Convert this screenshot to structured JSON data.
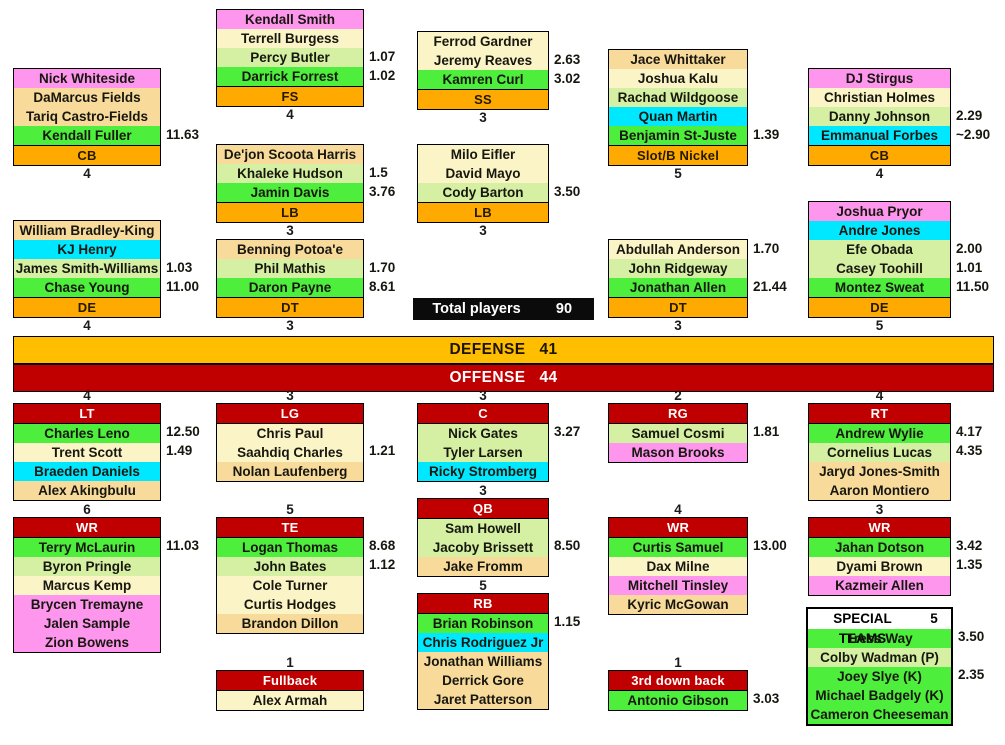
{
  "meta": {
    "total_label": "Total players",
    "total_value": "90",
    "defense_label": "DEFENSE",
    "defense_value": "41",
    "offense_label": "OFFENSE",
    "offense_value": "44"
  },
  "colors": {
    "defense_header": "#FFAA00",
    "offense_header": "#C00000",
    "banner_defense": "#FFBF00",
    "banner_offense": "#C00000",
    "tier_magenta": "#FF96EE",
    "tier_cyan": "#00E8FF",
    "tier_green": "#4DEE3C",
    "tier_light_green": "#D5F0A2",
    "tier_cream": "#FBF4C6",
    "tier_tan": "#F8DA9B",
    "total_box": "#0b0b0b"
  },
  "defense": [
    {
      "id": "cb-left",
      "position": "CB",
      "count": "4",
      "players": [
        {
          "name": "Nick Whiteside",
          "tier": "magenta",
          "value": ""
        },
        {
          "name": "DaMarcus Fields",
          "tier": "tan",
          "value": ""
        },
        {
          "name": "Tariq Castro-Fields",
          "tier": "tan",
          "value": ""
        },
        {
          "name": "Kendall Fuller",
          "tier": "green",
          "value": "11.63"
        }
      ]
    },
    {
      "id": "fs",
      "position": "FS",
      "count": "4",
      "players": [
        {
          "name": "Kendall Smith",
          "tier": "magenta",
          "value": ""
        },
        {
          "name": "Terrell Burgess",
          "tier": "cream",
          "value": ""
        },
        {
          "name": "Percy Butler",
          "tier": "ltgreen",
          "value": "1.07"
        },
        {
          "name": "Darrick Forrest",
          "tier": "green",
          "value": "1.02"
        }
      ]
    },
    {
      "id": "ss",
      "position": "SS",
      "count": "3",
      "players": [
        {
          "name": "Ferrod Gardner",
          "tier": "cream",
          "value": ""
        },
        {
          "name": "Jeremy Reaves",
          "tier": "cream",
          "value": "2.63"
        },
        {
          "name": "Kamren Curl",
          "tier": "green",
          "value": "3.02"
        }
      ]
    },
    {
      "id": "slot-nickel",
      "position": "Slot/B Nickel",
      "count": "5",
      "players": [
        {
          "name": "Jace Whittaker",
          "tier": "tan",
          "value": ""
        },
        {
          "name": "Joshua Kalu",
          "tier": "cream",
          "value": ""
        },
        {
          "name": "Rachad Wildgoose",
          "tier": "ltgreen",
          "value": ""
        },
        {
          "name": "Quan Martin",
          "tier": "cyan",
          "value": ""
        },
        {
          "name": "Benjamin St-Juste",
          "tier": "green",
          "value": "1.39"
        }
      ]
    },
    {
      "id": "cb-right",
      "position": "CB",
      "count": "4",
      "players": [
        {
          "name": "DJ Stirgus",
          "tier": "magenta",
          "value": ""
        },
        {
          "name": "Christian Holmes",
          "tier": "cream",
          "value": ""
        },
        {
          "name": "Danny Johnson",
          "tier": "ltgreen",
          "value": "2.29"
        },
        {
          "name": "Emmanual Forbes",
          "tier": "cyan",
          "value": "~2.90"
        }
      ]
    },
    {
      "id": "lb-left",
      "position": "LB",
      "count": "3",
      "players": [
        {
          "name": "De'jon Scoota Harris",
          "tier": "tan",
          "value": ""
        },
        {
          "name": "Khaleke Hudson",
          "tier": "ltgreen",
          "value": "1.5"
        },
        {
          "name": "Jamin Davis",
          "tier": "green",
          "value": "3.76"
        }
      ]
    },
    {
      "id": "lb-right",
      "position": "LB",
      "count": "3",
      "players": [
        {
          "name": "Milo Eifler",
          "tier": "cream",
          "value": ""
        },
        {
          "name": "David Mayo",
          "tier": "cream",
          "value": ""
        },
        {
          "name": "Cody Barton",
          "tier": "ltgreen",
          "value": "3.50"
        }
      ]
    },
    {
      "id": "de-left",
      "position": "DE",
      "count": "4",
      "players": [
        {
          "name": "William Bradley-King",
          "tier": "tan",
          "value": ""
        },
        {
          "name": "KJ Henry",
          "tier": "cyan",
          "value": ""
        },
        {
          "name": "James Smith-Williams",
          "tier": "ltgreen",
          "value": "1.03"
        },
        {
          "name": "Chase Young",
          "tier": "green",
          "value": "11.00"
        }
      ]
    },
    {
      "id": "dt-left",
      "position": "DT",
      "count": "3",
      "players": [
        {
          "name": "Benning Potoa'e",
          "tier": "tan",
          "value": ""
        },
        {
          "name": "Phil Mathis",
          "tier": "ltgreen",
          "value": "1.70"
        },
        {
          "name": "Daron Payne",
          "tier": "green",
          "value": "8.61"
        }
      ]
    },
    {
      "id": "dt-right",
      "position": "DT",
      "count": "3",
      "players": [
        {
          "name": "Abdullah Anderson",
          "tier": "cream",
          "value": "1.70"
        },
        {
          "name": "John Ridgeway",
          "tier": "ltgreen",
          "value": ""
        },
        {
          "name": "Jonathan Allen",
          "tier": "green",
          "value": "21.44"
        }
      ]
    },
    {
      "id": "de-right",
      "position": "DE",
      "count": "5",
      "players": [
        {
          "name": "Joshua Pryor",
          "tier": "magenta",
          "value": ""
        },
        {
          "name": "Andre Jones",
          "tier": "cyan",
          "value": ""
        },
        {
          "name": "Efe Obada",
          "tier": "ltgreen",
          "value": "2.00"
        },
        {
          "name": "Casey Toohill",
          "tier": "ltgreen",
          "value": "1.01"
        },
        {
          "name": "Montez Sweat",
          "tier": "green",
          "value": "11.50"
        }
      ]
    }
  ],
  "offense": [
    {
      "id": "lt",
      "position": "LT",
      "count": "4",
      "players": [
        {
          "name": "Charles Leno",
          "tier": "green",
          "value": "12.50"
        },
        {
          "name": "Trent Scott",
          "tier": "cream",
          "value": "1.49"
        },
        {
          "name": "Braeden Daniels",
          "tier": "cyan",
          "value": ""
        },
        {
          "name": "Alex Akingbulu",
          "tier": "tan",
          "value": ""
        }
      ]
    },
    {
      "id": "lg",
      "position": "LG",
      "count": "3",
      "players": [
        {
          "name": "Chris Paul",
          "tier": "cream",
          "value": ""
        },
        {
          "name": "Saahdiq Charles",
          "tier": "cream",
          "value": "1.21"
        },
        {
          "name": "Nolan Laufenberg",
          "tier": "tan",
          "value": ""
        }
      ]
    },
    {
      "id": "c",
      "position": "C",
      "count": "3",
      "players": [
        {
          "name": "Nick Gates",
          "tier": "ltgreen",
          "value": "3.27"
        },
        {
          "name": "Tyler Larsen",
          "tier": "ltgreen",
          "value": ""
        },
        {
          "name": "Ricky Stromberg",
          "tier": "cyan",
          "value": ""
        }
      ]
    },
    {
      "id": "rg",
      "position": "RG",
      "count": "2",
      "players": [
        {
          "name": "Samuel Cosmi",
          "tier": "ltgreen",
          "value": "1.81"
        },
        {
          "name": "Mason Brooks",
          "tier": "magenta",
          "value": ""
        }
      ]
    },
    {
      "id": "rt",
      "position": "RT",
      "count": "4",
      "players": [
        {
          "name": "Andrew Wylie",
          "tier": "green",
          "value": "4.17"
        },
        {
          "name": "Cornelius Lucas",
          "tier": "ltgreen",
          "value": "4.35"
        },
        {
          "name": "Jaryd Jones-Smith",
          "tier": "tan",
          "value": ""
        },
        {
          "name": "Aaron Montiero",
          "tier": "tan",
          "value": ""
        }
      ]
    },
    {
      "id": "wr-left",
      "position": "WR",
      "count": "6",
      "players": [
        {
          "name": "Terry McLaurin",
          "tier": "green",
          "value": "11.03"
        },
        {
          "name": "Byron Pringle",
          "tier": "ltgreen",
          "value": ""
        },
        {
          "name": "Marcus Kemp",
          "tier": "cream",
          "value": ""
        },
        {
          "name": "Brycen Tremayne",
          "tier": "magenta",
          "value": ""
        },
        {
          "name": "Jalen Sample",
          "tier": "magenta",
          "value": ""
        },
        {
          "name": "Zion Bowens",
          "tier": "magenta",
          "value": ""
        }
      ]
    },
    {
      "id": "te",
      "position": "TE",
      "count": "5",
      "players": [
        {
          "name": "Logan Thomas",
          "tier": "green",
          "value": "8.68"
        },
        {
          "name": "John Bates",
          "tier": "ltgreen",
          "value": "1.12"
        },
        {
          "name": "Cole Turner",
          "tier": "cream",
          "value": ""
        },
        {
          "name": "Curtis Hodges",
          "tier": "cream",
          "value": ""
        },
        {
          "name": "Brandon Dillon",
          "tier": "tan",
          "value": ""
        }
      ]
    },
    {
      "id": "qb",
      "position": "QB",
      "count": "3",
      "players": [
        {
          "name": "Sam Howell",
          "tier": "ltgreen",
          "value": ""
        },
        {
          "name": "Jacoby Brissett",
          "tier": "ltgreen",
          "value": "8.50"
        },
        {
          "name": "Jake Fromm",
          "tier": "tan",
          "value": ""
        }
      ]
    },
    {
      "id": "wr-mid",
      "position": "WR",
      "count": "4",
      "players": [
        {
          "name": "Curtis Samuel",
          "tier": "green",
          "value": "13.00"
        },
        {
          "name": "Dax Milne",
          "tier": "cream",
          "value": ""
        },
        {
          "name": "Mitchell Tinsley",
          "tier": "magenta",
          "value": ""
        },
        {
          "name": "Kyric McGowan",
          "tier": "tan",
          "value": ""
        }
      ]
    },
    {
      "id": "wr-right",
      "position": "WR",
      "count": "3",
      "players": [
        {
          "name": "Jahan Dotson",
          "tier": "green",
          "value": "3.42"
        },
        {
          "name": "Dyami Brown",
          "tier": "cream",
          "value": "1.35"
        },
        {
          "name": "Kazmeir Allen",
          "tier": "magenta",
          "value": ""
        }
      ]
    },
    {
      "id": "rb",
      "position": "RB",
      "count": "5",
      "players": [
        {
          "name": "Brian Robinson",
          "tier": "green",
          "value": "1.15"
        },
        {
          "name": "Chris Rodriguez Jr",
          "tier": "cyan",
          "value": ""
        },
        {
          "name": "Jonathan Williams",
          "tier": "tan",
          "value": ""
        },
        {
          "name": "Derrick Gore",
          "tier": "tan",
          "value": ""
        },
        {
          "name": "Jaret Patterson",
          "tier": "tan",
          "value": ""
        }
      ]
    },
    {
      "id": "fullback",
      "position": "Fullback",
      "count": "1",
      "players": [
        {
          "name": "Alex Armah",
          "tier": "cream",
          "value": ""
        }
      ]
    },
    {
      "id": "third-down-back",
      "position": "3rd down back",
      "count": "1",
      "players": [
        {
          "name": "Antonio Gibson",
          "tier": "green",
          "value": "3.03"
        }
      ]
    }
  ],
  "special_teams": {
    "title": "SPECIAL TEAMS",
    "count": "5",
    "players": [
      {
        "name": "Tress Way",
        "tier": "green",
        "value": "3.50"
      },
      {
        "name": "Colby Wadman (P)",
        "tier": "ltgreen",
        "value": ""
      },
      {
        "name": "Joey Slye (K)",
        "tier": "green",
        "value": "2.35"
      },
      {
        "name": "Michael Badgely (K)",
        "tier": "green",
        "value": ""
      },
      {
        "name": "Cameron Cheeseman",
        "tier": "green",
        "value": ""
      }
    ]
  }
}
